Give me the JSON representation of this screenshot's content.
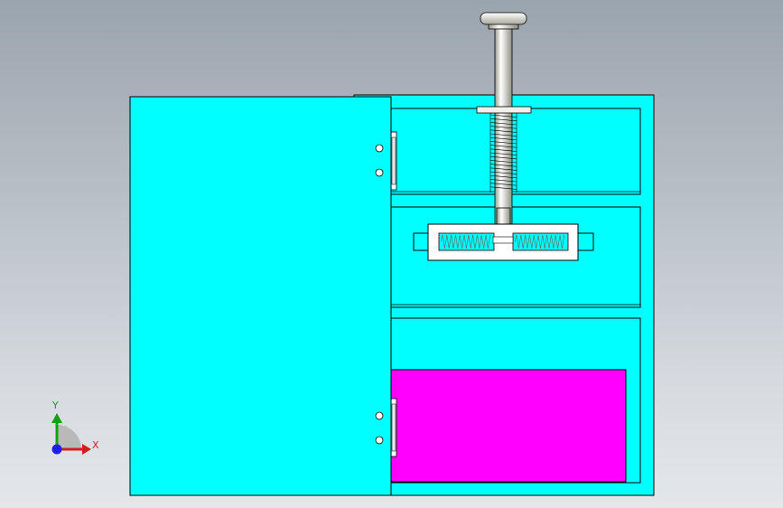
{
  "app": {
    "type": "cad-3d-viewport",
    "background_top": "#9aa4ae",
    "background_bottom": "#e4e7ea"
  },
  "model": {
    "cabinet_color": "#00ffff",
    "drawer_color": "#ff00ff",
    "door_color": "#00ffff",
    "edge_color": "#000000",
    "shaft_color": "#e8e8dc",
    "hinge_color": "#ffffff",
    "spring_color": "#7a7a7a"
  },
  "triad": {
    "y_label": "Y",
    "x_label": "X",
    "y_color": "#14a014",
    "x_color": "#d21e1e",
    "z_color": "#1e1ef0"
  }
}
